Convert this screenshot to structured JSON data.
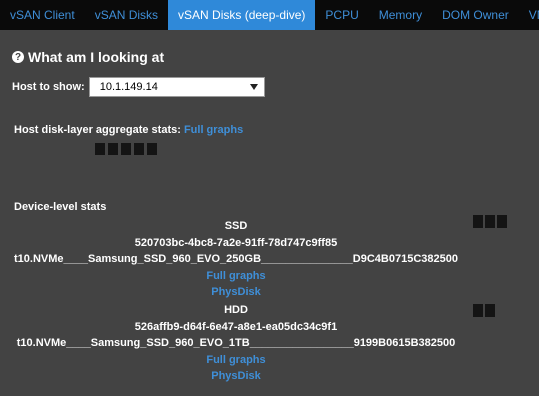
{
  "nav": {
    "tabs": [
      {
        "label": "vSAN Client",
        "active": false
      },
      {
        "label": "vSAN Disks",
        "active": false
      },
      {
        "label": "vSAN Disks (deep-dive)",
        "active": true
      },
      {
        "label": "PCPU",
        "active": false
      },
      {
        "label": "Memory",
        "active": false
      },
      {
        "label": "DOM Owner",
        "active": false
      },
      {
        "label": "VMs",
        "active": false
      }
    ]
  },
  "section": {
    "help_icon": "question-circle-icon",
    "title": "What am I looking at"
  },
  "host": {
    "label": "Host to show:",
    "selected": "10.1.149.14"
  },
  "aggregate": {
    "label": "Host disk-layer aggregate stats:",
    "link": "Full graphs"
  },
  "devices": {
    "label": "Device-level stats",
    "items": [
      {
        "type": "SSD",
        "uuid": "520703bc-4bc8-7a2e-91ff-78d747c9ff85",
        "name": "t10.NVMe____Samsung_SSD_960_EVO_250GB_______________D9C4B0715C382500",
        "full_graphs_link": "Full graphs",
        "physdisk_link": "PhysDisk"
      },
      {
        "type": "HDD",
        "uuid": "526affb9-d64f-6e47-a8e1-ea05dc34c9f1",
        "name": "t10.NVMe____Samsung_SSD_960_EVO_1TB_________________9199B0615B382500",
        "full_graphs_link": "Full graphs",
        "physdisk_link": "PhysDisk"
      }
    ]
  },
  "colors": {
    "background": "#434343",
    "navbar": "#0a0a0a",
    "active_tab": "#2f89d9",
    "link": "#3f8fd8"
  }
}
